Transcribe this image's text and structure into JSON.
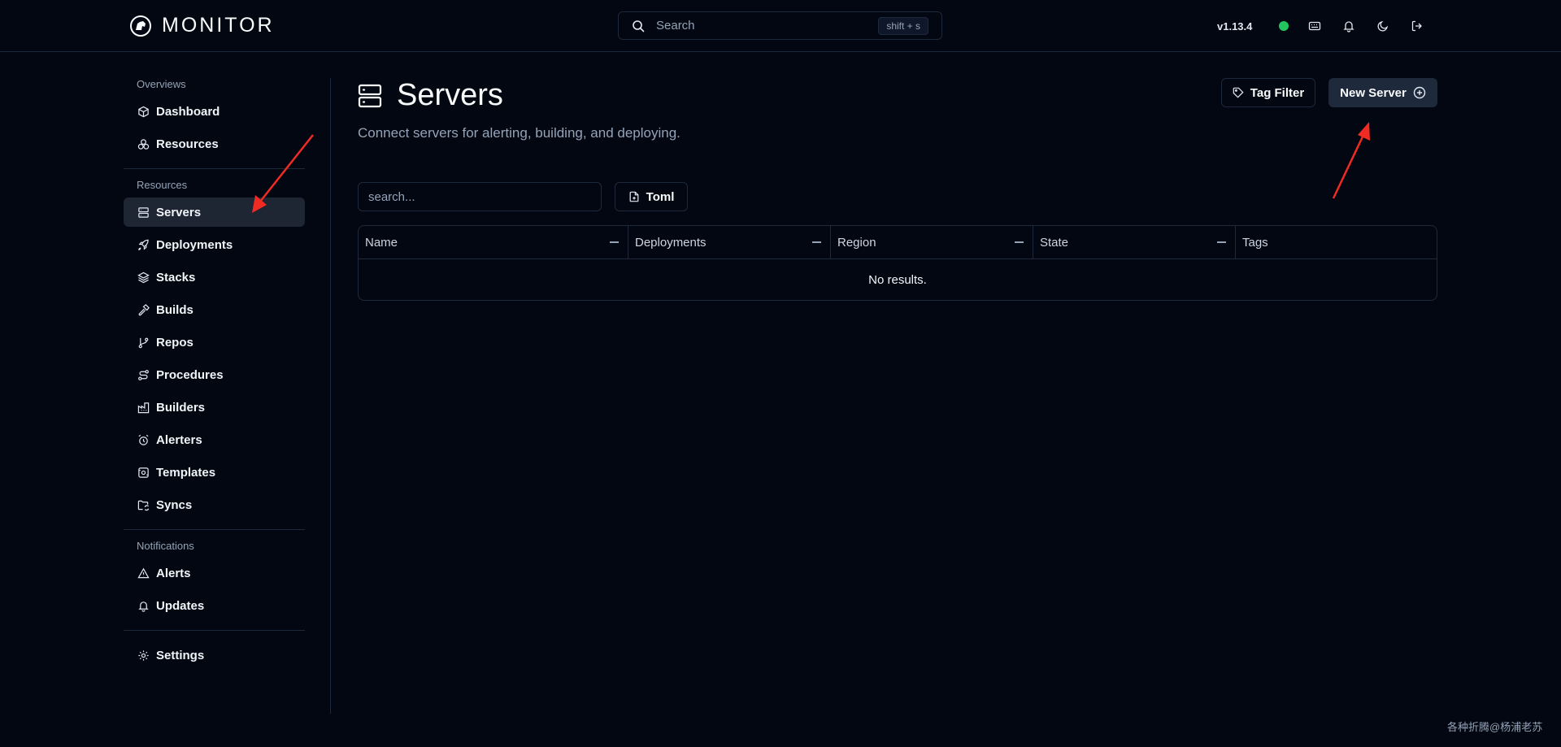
{
  "app": {
    "name": "MONITOR",
    "version": "v1.13.4"
  },
  "header": {
    "search_placeholder": "Search",
    "search_shortcut": "shift + s",
    "status_color": "#22c55e",
    "icons": [
      "keyboard-icon",
      "bell-icon",
      "moon-icon",
      "logout-icon"
    ]
  },
  "sidebar": {
    "sections": [
      {
        "label": "Overviews",
        "items": [
          {
            "label": "Dashboard",
            "icon": "box-icon"
          },
          {
            "label": "Resources",
            "icon": "boxes-icon"
          }
        ]
      },
      {
        "label": "Resources",
        "items": [
          {
            "label": "Servers",
            "icon": "server-icon",
            "active": true
          },
          {
            "label": "Deployments",
            "icon": "rocket-icon"
          },
          {
            "label": "Stacks",
            "icon": "layers-icon"
          },
          {
            "label": "Builds",
            "icon": "hammer-icon"
          },
          {
            "label": "Repos",
            "icon": "git-branch-icon"
          },
          {
            "label": "Procedures",
            "icon": "route-icon"
          },
          {
            "label": "Builders",
            "icon": "factory-icon"
          },
          {
            "label": "Alerters",
            "icon": "alarm-clock-icon"
          },
          {
            "label": "Templates",
            "icon": "template-icon"
          },
          {
            "label": "Syncs",
            "icon": "folder-sync-icon"
          }
        ]
      },
      {
        "label": "Notifications",
        "items": [
          {
            "label": "Alerts",
            "icon": "alert-triangle-icon"
          },
          {
            "label": "Updates",
            "icon": "bell-icon"
          }
        ]
      }
    ],
    "settings": {
      "label": "Settings",
      "icon": "gear-icon"
    }
  },
  "main": {
    "title": "Servers",
    "subtitle": "Connect servers for alerting, building, and deploying.",
    "tag_filter_label": "Tag Filter",
    "new_server_label": "New Server",
    "filter_placeholder": "search...",
    "toml_label": "Toml",
    "table": {
      "columns": [
        "Name",
        "Deployments",
        "Region",
        "State",
        "Tags"
      ],
      "empty_text": "No results."
    }
  },
  "watermark": "各种折腾@杨浦老苏"
}
